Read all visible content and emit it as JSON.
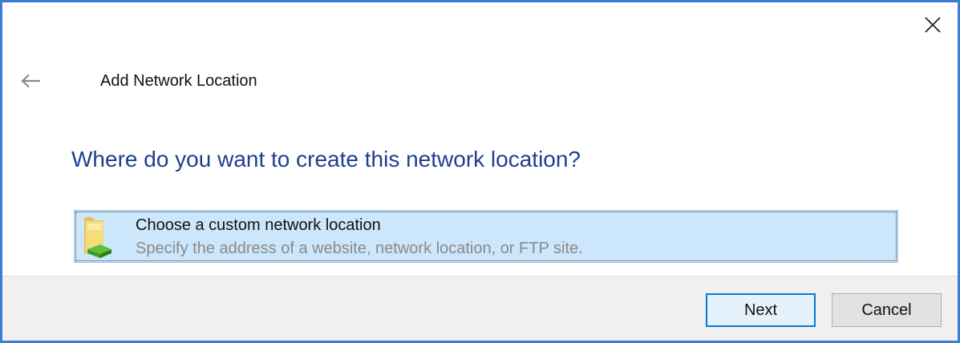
{
  "window": {
    "title": "Add Network Location",
    "accent_color": "#3d7bd9",
    "close_icon": "close-icon",
    "back_icon": "arrow-left-icon"
  },
  "main": {
    "heading": "Where do you want to create this network location?",
    "heading_color": "#1e3f8f",
    "options": [
      {
        "icon": "network-folder-icon",
        "title": "Choose a custom network location",
        "description": "Specify the address of a website, network location, or FTP site.",
        "selected": true
      }
    ]
  },
  "footer": {
    "next_label": "Next",
    "cancel_label": "Cancel"
  }
}
